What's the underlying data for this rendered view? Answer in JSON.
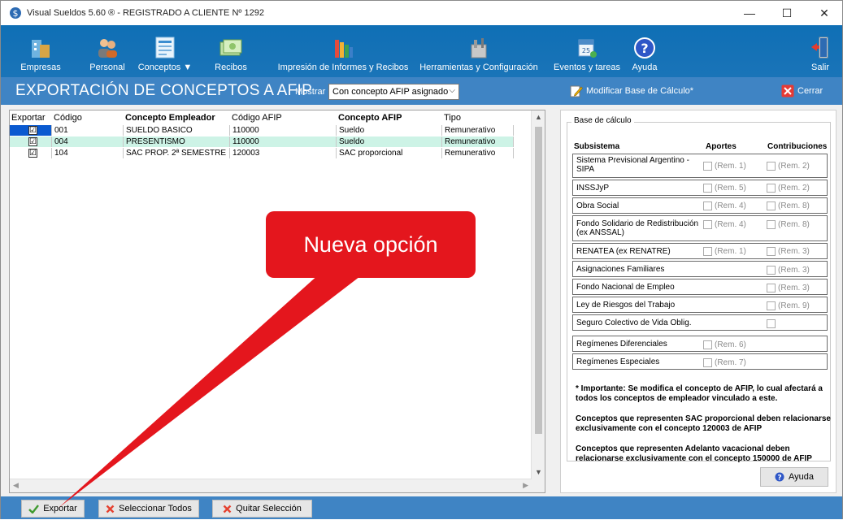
{
  "window": {
    "title": "Visual Sueldos 5.60 ®   - REGISTRADO A CLIENTE Nº 1292",
    "minimize": "—",
    "maximize": "☐",
    "close": "✕"
  },
  "toolbar": {
    "empresas": "Empresas",
    "personal": "Personal",
    "conceptos": "Conceptos ▼",
    "recibos": "Recibos",
    "impresion": "Impresión de Informes y Recibos",
    "herramientas": "Herramientas y Configuración",
    "eventos": "Eventos y tareas",
    "ayuda": "Ayuda",
    "salir": "Salir"
  },
  "header": {
    "title": "EXPORTACIÓN DE CONCEPTOS A AFIP",
    "mostrar_label": "Mostrar",
    "mostrar_value": "Con concepto AFIP asignado",
    "modificar": "Modificar Base de Cálculo*",
    "cerrar": "Cerrar"
  },
  "grid": {
    "columns": {
      "exportar": "Exportar",
      "codigo": "Código",
      "concepto_empleador": "Concepto Empleador",
      "codigo_afip": "Código AFIP",
      "concepto_afip": "Concepto AFIP",
      "tipo": "Tipo"
    },
    "rows": [
      {
        "check": "☑",
        "codigo": "001",
        "concepto": "SUELDO BASICO",
        "codigo_afip": "110000",
        "concepto_afip": "Sueldo",
        "tipo": "Remunerativo"
      },
      {
        "check": "☑",
        "codigo": "004",
        "concepto": "PRESENTISMO",
        "codigo_afip": "110000",
        "concepto_afip": "Sueldo",
        "tipo": "Remunerativo"
      },
      {
        "check": "☑",
        "codigo": "104",
        "concepto": "SAC PROP. 2ª SEMESTRE",
        "codigo_afip": "120003",
        "concepto_afip": "SAC proporcional",
        "tipo": "Remunerativo"
      }
    ]
  },
  "base": {
    "legend": "Base de cálculo",
    "col_subsistema": "Subsistema",
    "col_aportes": "Aportes",
    "col_contribuciones": "Contribuciones",
    "rows": [
      {
        "name": "Sistema Previsional Argentino - SIPA",
        "aporte": "(Rem. 1)",
        "contrib": "(Rem. 2)"
      },
      {
        "name": "INSSJyP",
        "aporte": "(Rem. 5)",
        "contrib": "(Rem. 2)"
      },
      {
        "name": "Obra Social",
        "aporte": "(Rem. 4)",
        "contrib": "(Rem. 8)"
      },
      {
        "name": "Fondo Solidario de Redistribución (ex ANSSAL)",
        "aporte": "(Rem. 4)",
        "contrib": "(Rem. 8)"
      },
      {
        "name": "RENATEA (ex RENATRE)",
        "aporte": "(Rem. 1)",
        "contrib": "(Rem. 3)"
      },
      {
        "name": "Asignaciones Familiares",
        "aporte": "",
        "contrib": "(Rem. 3)"
      },
      {
        "name": "Fondo Nacional de Empleo",
        "aporte": "",
        "contrib": "(Rem. 3)"
      },
      {
        "name": "Ley de Riesgos del Trabajo",
        "aporte": "",
        "contrib": "(Rem. 9)"
      },
      {
        "name": "Seguro Colectivo de Vida Oblig.",
        "aporte": "",
        "contrib": ""
      },
      {
        "name": "Regímenes Diferenciales",
        "aporte": "(Rem. 6)",
        "contrib": ""
      },
      {
        "name": "Regímenes Especiales",
        "aporte": "(Rem. 7)",
        "contrib": ""
      }
    ],
    "note1": "* Importante: Se modifica el concepto de AFIP, lo cual afectará a todos los conceptos de empleador vinculado a este.",
    "note2": "Conceptos que representen SAC proporcional deben relacionarse exclusivamente con el concepto 120003 de AFIP",
    "note3": "Conceptos que representen Adelanto vacacional deben relacionarse exclusivamente con el concepto 150000 de AFIP",
    "ayuda": "Ayuda"
  },
  "footer": {
    "exportar": "Exportar",
    "seleccionar": "Seleccionar Todos",
    "quitar": "Quitar Selección"
  },
  "callout": {
    "text": "Nueva opción"
  },
  "colors": {
    "ribbon": "#1470b6",
    "header": "#3f84c4",
    "selected_row": "#cdf3e6",
    "callout": "#e4161d"
  }
}
